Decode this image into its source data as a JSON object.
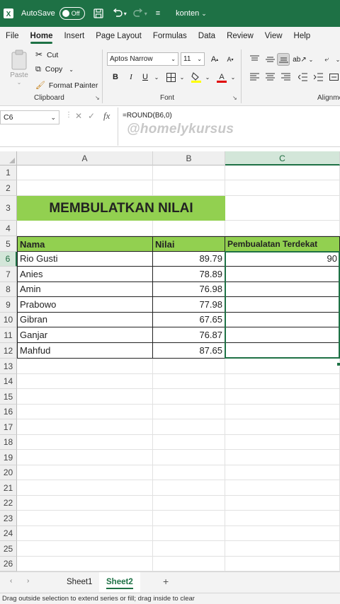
{
  "titlebar": {
    "autosave_label": "AutoSave",
    "autosave_state": "Off",
    "filename": "konten",
    "accent": "#1e7145"
  },
  "menu": [
    "File",
    "Home",
    "Insert",
    "Page Layout",
    "Formulas",
    "Data",
    "Review",
    "View",
    "Help"
  ],
  "menu_active": "Home",
  "ribbon": {
    "clipboard": {
      "paste": "Paste",
      "cut": "Cut",
      "copy": "Copy",
      "format_painter": "Format Painter",
      "label": "Clipboard"
    },
    "font": {
      "font_name": "Aptos Narrow",
      "font_size": "11",
      "bold": "B",
      "italic": "I",
      "underline": "U",
      "label": "Font"
    },
    "alignment": {
      "label": "Alignme"
    }
  },
  "formula_bar": {
    "name_box": "C6",
    "cancel": "✕",
    "enter": "✓",
    "fx": "fx",
    "formula": "=ROUND(B6,0)",
    "watermark": "@homelykursus"
  },
  "sheet": {
    "columns": [
      "A",
      "B",
      "C"
    ],
    "selected_column": "C",
    "selected_row": "6",
    "rows": [
      "1",
      "2",
      "3",
      "4",
      "5",
      "6",
      "7",
      "8",
      "9",
      "10",
      "11",
      "12",
      "13",
      "14",
      "15",
      "16",
      "17",
      "18",
      "19",
      "20",
      "21",
      "22",
      "23",
      "24",
      "25",
      "26"
    ],
    "title": "MEMBULATKAN NILAI",
    "headers": [
      "Nama",
      "Nilai",
      "Pembualatan Terdekat"
    ],
    "header_fill": "#92d050",
    "data": [
      {
        "nama": "Rio Gusti",
        "nilai": "89.79",
        "bulat": "90"
      },
      {
        "nama": "Anies",
        "nilai": "78.89",
        "bulat": ""
      },
      {
        "nama": "Amin",
        "nilai": "76.98",
        "bulat": ""
      },
      {
        "nama": "Prabowo",
        "nilai": "77.98",
        "bulat": ""
      },
      {
        "nama": "Gibran",
        "nilai": "67.65",
        "bulat": ""
      },
      {
        "nama": "Ganjar",
        "nilai": "76.87",
        "bulat": ""
      },
      {
        "nama": "Mahfud",
        "nilai": "87.65",
        "bulat": ""
      }
    ]
  },
  "tabs": {
    "items": [
      "Sheet1",
      "Sheet2"
    ],
    "active": "Sheet2",
    "add": "+"
  },
  "status": "Drag outside selection to extend series or fill; drag inside to clear"
}
